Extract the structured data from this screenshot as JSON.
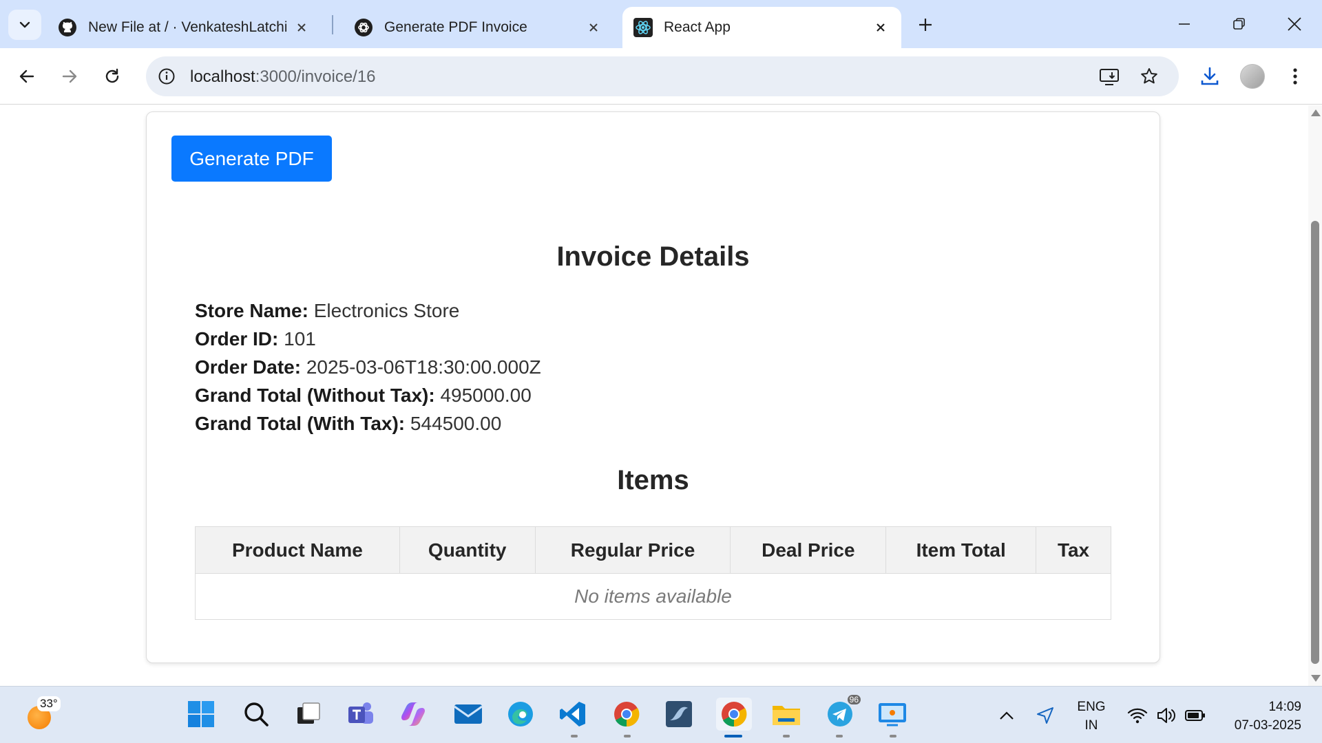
{
  "browser": {
    "tabs": [
      {
        "title": "New File at / · VenkateshLatchir",
        "favicon": "github-icon"
      },
      {
        "title": "Generate PDF Invoice",
        "favicon": "chatgpt-icon"
      },
      {
        "title": "React App",
        "favicon": "react-icon"
      }
    ],
    "active_tab": 2,
    "url_host": "localhost",
    "url_path": ":3000/invoice/16"
  },
  "page": {
    "generate_button": "Generate PDF",
    "invoice_title": "Invoice Details",
    "details": [
      {
        "label": "Store Name:",
        "value": "Electronics Store"
      },
      {
        "label": "Order ID:",
        "value": "101"
      },
      {
        "label": "Order Date:",
        "value": "2025-03-06T18:30:00.000Z"
      },
      {
        "label": "Grand Total (Without Tax):",
        "value": "495000.00"
      },
      {
        "label": "Grand Total (With Tax):",
        "value": "544500.00"
      }
    ],
    "items_title": "Items",
    "table_headers": [
      "Product Name",
      "Quantity",
      "Regular Price",
      "Deal Price",
      "Item Total",
      "Tax"
    ],
    "empty_message": "No items available"
  },
  "taskbar": {
    "weather_temp": "33°",
    "telegram_badge": "96",
    "lang_top": "ENG",
    "lang_bottom": "IN",
    "time": "14:09",
    "date": "07-03-2025"
  },
  "colors": {
    "primary_button": "#0a79ff",
    "tab_strip": "#d3e3fd",
    "taskbar": "#dfe8f5"
  }
}
